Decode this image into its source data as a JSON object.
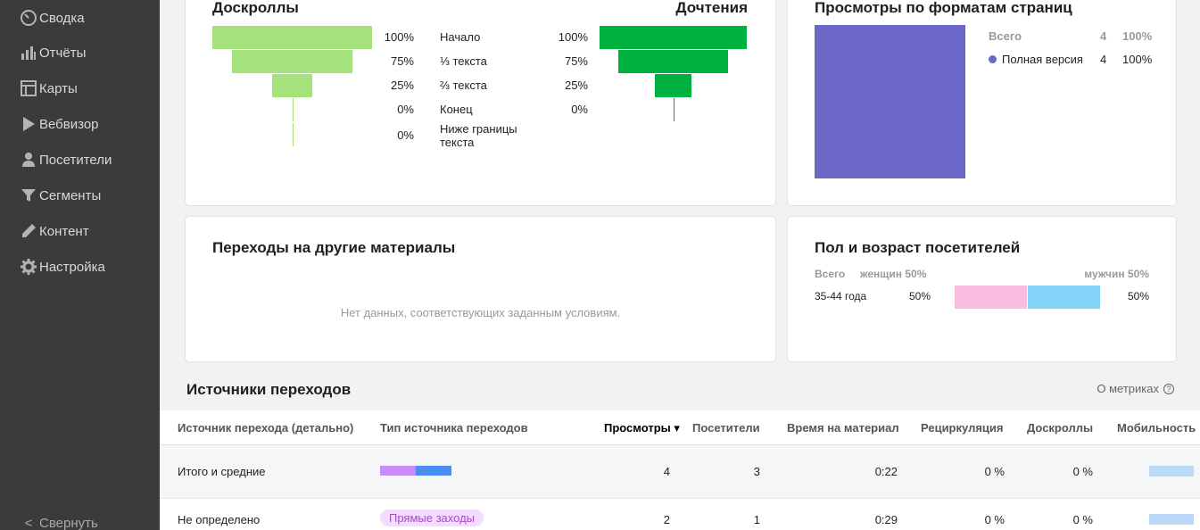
{
  "sidebar": {
    "items": [
      {
        "label": "Сводка",
        "icon": "gauge-icon"
      },
      {
        "label": "Отчёты",
        "icon": "bar-chart-icon"
      },
      {
        "label": "Карты",
        "icon": "map-layout-icon"
      },
      {
        "label": "Вебвизор",
        "icon": "play-icon"
      },
      {
        "label": "Посетители",
        "icon": "user-icon"
      },
      {
        "label": "Сегменты",
        "icon": "filter-icon"
      },
      {
        "label": "Контент",
        "icon": "pencil-icon"
      },
      {
        "label": "Настройка",
        "icon": "gear-icon"
      }
    ],
    "collapse_label": "Свернуть",
    "collapse_icon": "<"
  },
  "funnel": {
    "title_left": "Доскроллы",
    "title_right": "Дочтения",
    "rows": [
      {
        "label": "Начало",
        "left_pct": "100%",
        "right_pct": "100%",
        "left_value": 100,
        "right_value": 100
      },
      {
        "label": "⅓ текста",
        "left_pct": "75%",
        "right_pct": "75%",
        "left_value": 75,
        "right_value": 75
      },
      {
        "label": "⅔ текста",
        "left_pct": "25%",
        "right_pct": "25%",
        "left_value": 25,
        "right_value": 25
      },
      {
        "label": "Конец",
        "left_pct": "0%",
        "right_pct": "0%",
        "left_value": 0,
        "right_value": 0
      },
      {
        "label": "Ниже границы текста",
        "left_pct": "0%",
        "right_pct": "",
        "left_value": 0,
        "right_value": null
      }
    ],
    "colors": {
      "left": "#a6e27b",
      "right": "#00b13f"
    }
  },
  "formats": {
    "title": "Просмотры по форматам страниц",
    "total_label": "Всего",
    "total_count": "4",
    "total_pct": "100%",
    "items": [
      {
        "label": "Полная версия",
        "count": "4",
        "pct": "100%",
        "color": "#6b67c7",
        "share": 1.0
      }
    ]
  },
  "transitions": {
    "title": "Переходы на другие материалы",
    "empty_message": "Нет данных, соответствующих заданным условиям."
  },
  "gender": {
    "title": "Пол и возраст посетителей",
    "total_label": "Всего",
    "women_label": "женщин",
    "women_pct": "50%",
    "men_label": "мужчин",
    "men_pct": "50%",
    "rows": [
      {
        "age": "35-44 года",
        "women_pct": "50%",
        "men_pct": "50%",
        "women_share": 0.5,
        "men_share": 0.5
      }
    ],
    "colors": {
      "women": "#f9bde0",
      "men": "#84d4f9"
    }
  },
  "sources": {
    "title": "Источники переходов",
    "about_label": "О метриках",
    "about_icon": "?",
    "columns": [
      "Источник перехода (детально)",
      "Тип источника переходов",
      "Просмотры ▾",
      "Посетители",
      "Время на материал",
      "Рециркуляция",
      "Доскроллы",
      "Мобильность"
    ],
    "rows": [
      {
        "source": "Итого и средние",
        "type_chip": "",
        "views": "4",
        "visitors": "3",
        "time": "0:22",
        "recirculation": "0 %",
        "scrolls": "0 %"
      },
      {
        "source": "Не определено",
        "type_chip": "Прямые заходы",
        "views": "2",
        "visitors": "1",
        "time": "0:29",
        "recirculation": "0 %",
        "scrolls": "0 %"
      }
    ],
    "total_type_bar": [
      {
        "share": 0.5,
        "color": "#c98cf6"
      },
      {
        "share": 0.5,
        "color": "#4a8ef3"
      }
    ]
  }
}
